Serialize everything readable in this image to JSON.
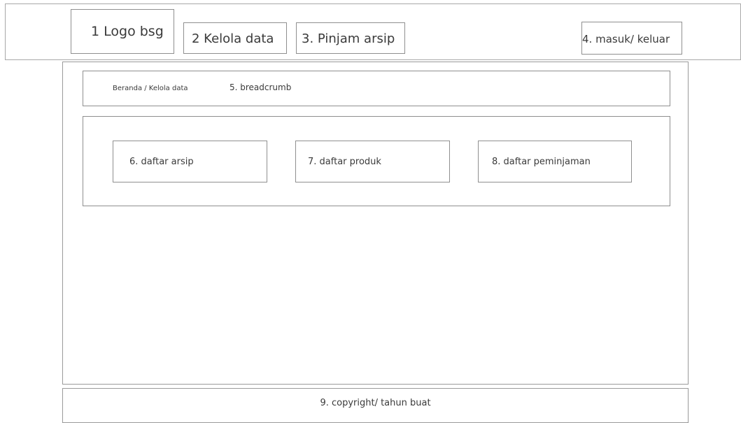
{
  "header": {
    "logo_label": "1 Logo bsg",
    "nav": {
      "kelola_label": "2 Kelola data",
      "pinjam_label": "3. Pinjam arsip"
    },
    "auth_label": "4. masuk/ keluar"
  },
  "breadcrumb": {
    "trail": "Beranda / Kelola data",
    "note": "5. breadcrumb"
  },
  "menu": {
    "items": [
      {
        "label": "6. daftar arsip"
      },
      {
        "label": "7. daftar produk"
      },
      {
        "label": "8. daftar peminjaman"
      }
    ]
  },
  "footer": {
    "text": "9. copyright/ tahun buat"
  }
}
